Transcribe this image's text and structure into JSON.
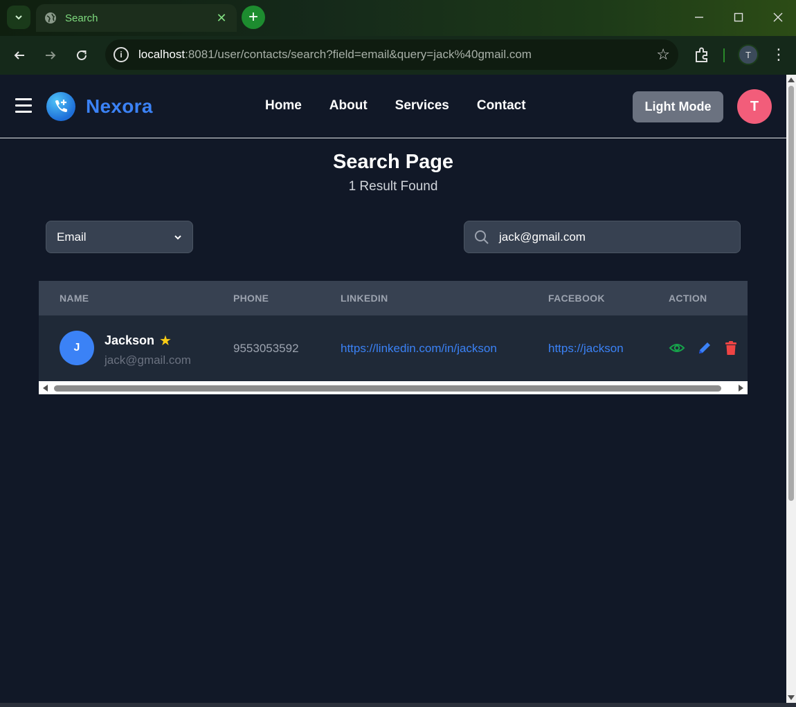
{
  "browser": {
    "tab_title": "Search",
    "url_host": "localhost",
    "url_rest": ":8081/user/contacts/search?field=email&query=jack%40gmail.com",
    "profile_initial": "T"
  },
  "navbar": {
    "brand": "Nexora",
    "links": [
      "Home",
      "About",
      "Services",
      "Contact"
    ],
    "mode_button": "Light Mode",
    "user_initial": "T"
  },
  "page": {
    "title": "Search Page",
    "result_count": "1 Result Found"
  },
  "search": {
    "field_selected": "Email",
    "query": "jack@gmail.com"
  },
  "table": {
    "headers": [
      "NAME",
      "PHONE",
      "LINKEDIN",
      "FACEBOOK",
      "ACTION"
    ],
    "rows": [
      {
        "initial": "J",
        "name": "Jackson",
        "email": "jack@gmail.com",
        "phone": "9553053592",
        "linkedin": "https://linkedin.com/in/jackson",
        "facebook": "https://jackson",
        "favorite": true
      }
    ]
  },
  "colors": {
    "accent": "#3b82f6",
    "view_icon": "#16a34a",
    "edit_icon": "#3b82f6",
    "delete_icon": "#ef4444",
    "avatar_user": "#f25d7a",
    "favorite_star": "#facc15"
  },
  "icons": {
    "view": "eye-icon",
    "edit": "pencil-icon",
    "delete": "trash-icon",
    "favorite": "star-icon",
    "search": "search-icon"
  }
}
